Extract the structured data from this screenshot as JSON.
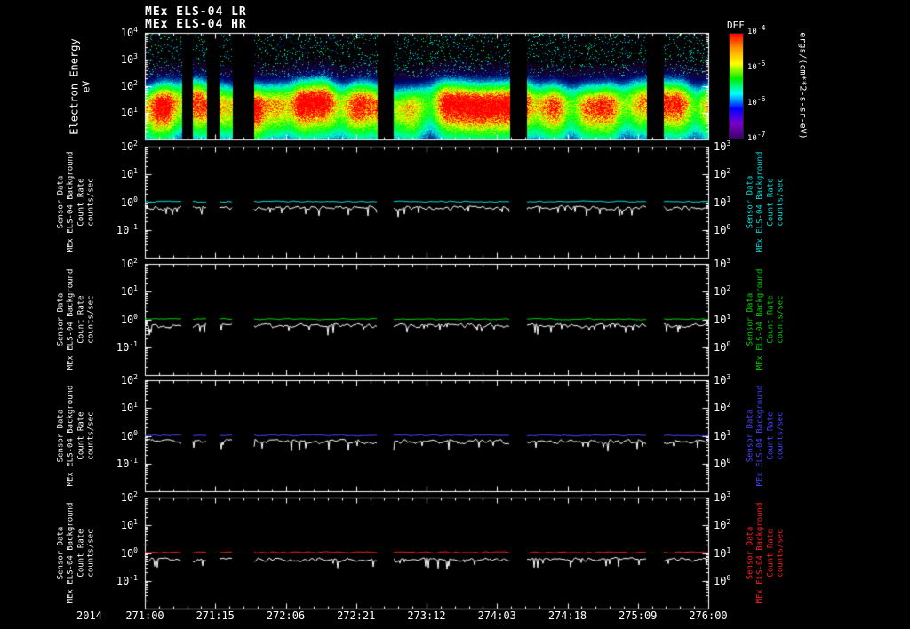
{
  "header": {
    "title_lr": "MEx ELS-04 LR",
    "title_hr": "MEx ELS-04 HR"
  },
  "footer": {
    "year_label": "2014"
  },
  "colors": {
    "background": "#000000",
    "axis": "#ffffff",
    "text": "#ffffff"
  },
  "chart_data": {
    "type": "heatmap",
    "description": "MEx ELS-04 electron spectrometer: energy-time differential energy flux spectrogram (LR/HR) for days 271-276 of 2014, with four background count-rate line panels below",
    "x_axis": {
      "format": "DOY:HH",
      "year": "2014",
      "tick_labels": [
        "271:00",
        "271:15",
        "272:06",
        "272:21",
        "273:12",
        "274:03",
        "274:18",
        "275:09",
        "276:00"
      ],
      "minor_ticks_per_major": 5
    },
    "data_gaps_fraction": [
      [
        0.066,
        0.085
      ],
      [
        0.109,
        0.131
      ],
      [
        0.156,
        0.194
      ],
      [
        0.413,
        0.441
      ],
      [
        0.647,
        0.677
      ],
      [
        0.891,
        0.921
      ]
    ],
    "spectrogram": {
      "ylabel": "Electron Energy",
      "yunit": "eV",
      "y_range_exponents": [
        0,
        4
      ],
      "ytick_exponents": [
        4,
        3,
        2,
        1
      ],
      "peak_band_energy_ev": [
        10,
        100
      ],
      "colorbar": {
        "title": "DEF",
        "tick_exponents": [
          -4,
          -5,
          -6,
          -7
        ],
        "unit": "ergs/(cm**2-s-sr-eV)",
        "gradient": [
          "#ff0000",
          "#ff9900",
          "#ffff00",
          "#00ee00",
          "#00ffff",
          "#0000ff",
          "#7a00cc",
          "#3a0066"
        ]
      }
    },
    "line_panels": [
      {
        "label_lines": [
          "Sensor Data",
          "MEx ELS-04 Background",
          "Count Rate",
          "counts/sec"
        ],
        "series_color": "#00dede",
        "white_series_color": "#ffffff",
        "left_tick_exponents": [
          2,
          1,
          0,
          -1
        ],
        "right_tick_exponents": [
          3,
          2,
          1,
          0
        ],
        "y_range_exponents": [
          -2,
          2
        ],
        "colored_series_level": 1.05,
        "white_series_level": 0.62
      },
      {
        "label_lines": [
          "Sensor Data",
          "MEx ELS-04 Background",
          "Count Rate",
          "counts/sec"
        ],
        "series_color": "#00d400",
        "white_series_color": "#ffffff",
        "left_tick_exponents": [
          2,
          1,
          0,
          -1
        ],
        "right_tick_exponents": [
          3,
          2,
          1,
          0
        ],
        "y_range_exponents": [
          -2,
          2
        ],
        "colored_series_level": 1.02,
        "white_series_level": 0.6
      },
      {
        "label_lines": [
          "Sensor Data",
          "MEx ELS-04 Background",
          "Count Rate",
          "counts/sec"
        ],
        "series_color": "#4646ff",
        "white_series_color": "#ffffff",
        "left_tick_exponents": [
          2,
          1,
          0,
          -1
        ],
        "right_tick_exponents": [
          3,
          2,
          1,
          0
        ],
        "y_range_exponents": [
          -2,
          2
        ],
        "colored_series_level": 1.04,
        "white_series_level": 0.63
      },
      {
        "label_lines": [
          "Sensor Data",
          "MEx ELS-04 Background",
          "Count Rate",
          "counts/sec"
        ],
        "series_color": "#ff2020",
        "white_series_color": "#ffffff",
        "left_tick_exponents": [
          2,
          1,
          0,
          -1
        ],
        "right_tick_exponents": [
          3,
          2,
          1,
          0
        ],
        "y_range_exponents": [
          -2,
          2
        ],
        "colored_series_level": 1.06,
        "white_series_level": 0.58
      }
    ]
  }
}
